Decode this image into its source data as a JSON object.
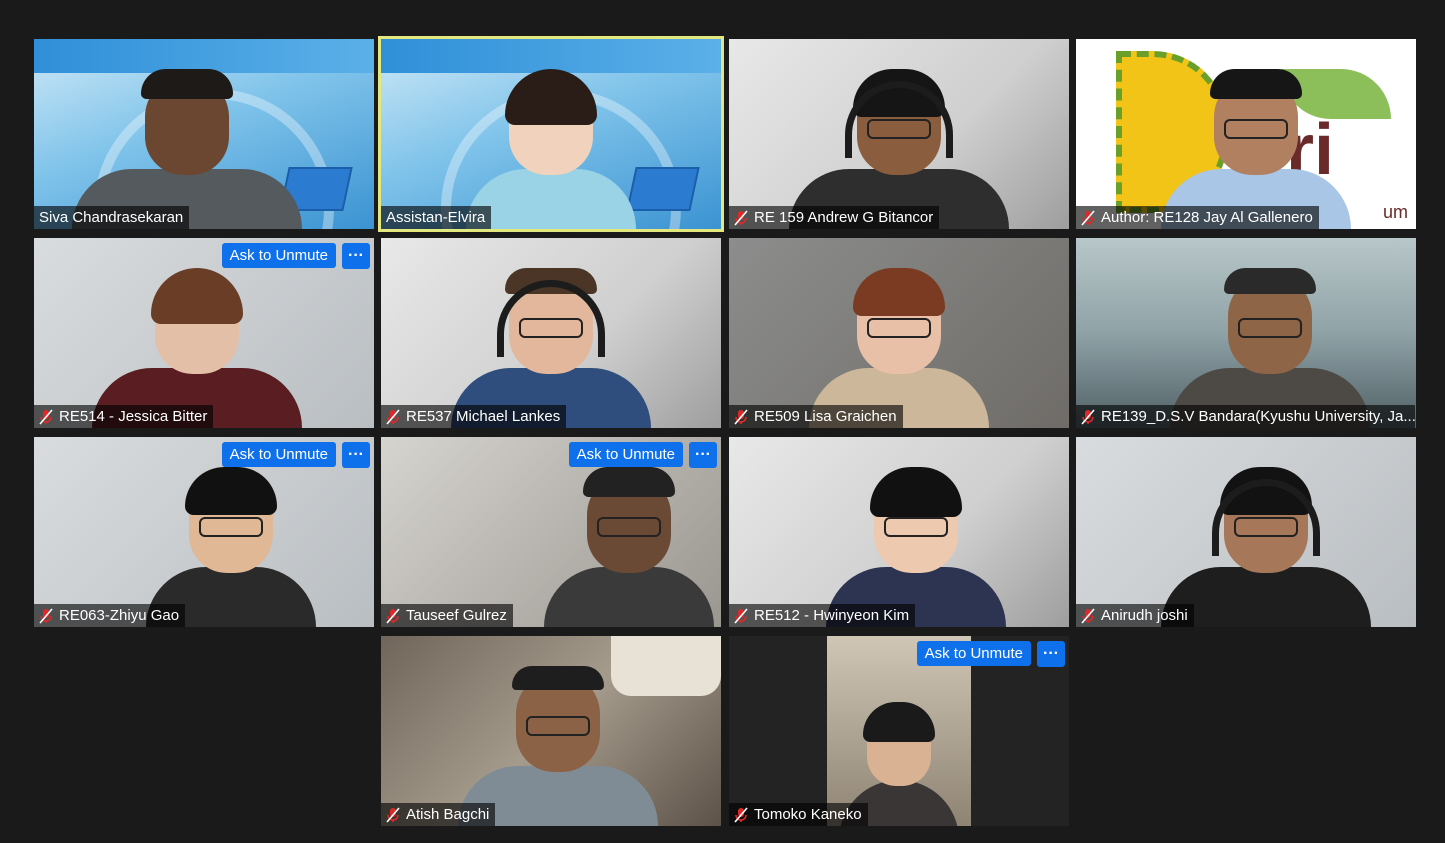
{
  "participants": [
    {
      "name": "Siva Chandrasekaran",
      "muted": false
    },
    {
      "name": "Assistan-Elvira",
      "muted": false,
      "active_speaker": true
    },
    {
      "name": "RE 159 Andrew G Bitancor",
      "muted": true
    },
    {
      "name": "Author: RE128 Jay Al Gallenero",
      "muted": true,
      "logo_text": "ri",
      "logo_sub": "um"
    },
    {
      "name": "RE514 - Jessica Bitter",
      "muted": true
    },
    {
      "name": "RE537 Michael Lankes",
      "muted": true
    },
    {
      "name": "RE509 Lisa Graichen",
      "muted": true
    },
    {
      "name": "RE139_D.S.V Bandara(Kyushu University, Ja...",
      "muted": true
    },
    {
      "name": "RE063-Zhiyu Gao",
      "muted": true
    },
    {
      "name": "Tauseef Gulrez",
      "muted": true
    },
    {
      "name": "RE512 - Hwinyeon Kim",
      "muted": true
    },
    {
      "name": "Anirudh joshi",
      "muted": true
    },
    {
      "name": "Atish Bagchi",
      "muted": true
    },
    {
      "name": "Tomoko Kaneko",
      "muted": true
    }
  ],
  "controls": {
    "ask_to_unmute_label": "Ask to Unmute",
    "more_label": "···"
  },
  "colors": {
    "background": "#1a1a1a",
    "active_speaker_border": "#e3e87e",
    "button_blue": "#0e71eb",
    "muted_red": "#e02828"
  }
}
